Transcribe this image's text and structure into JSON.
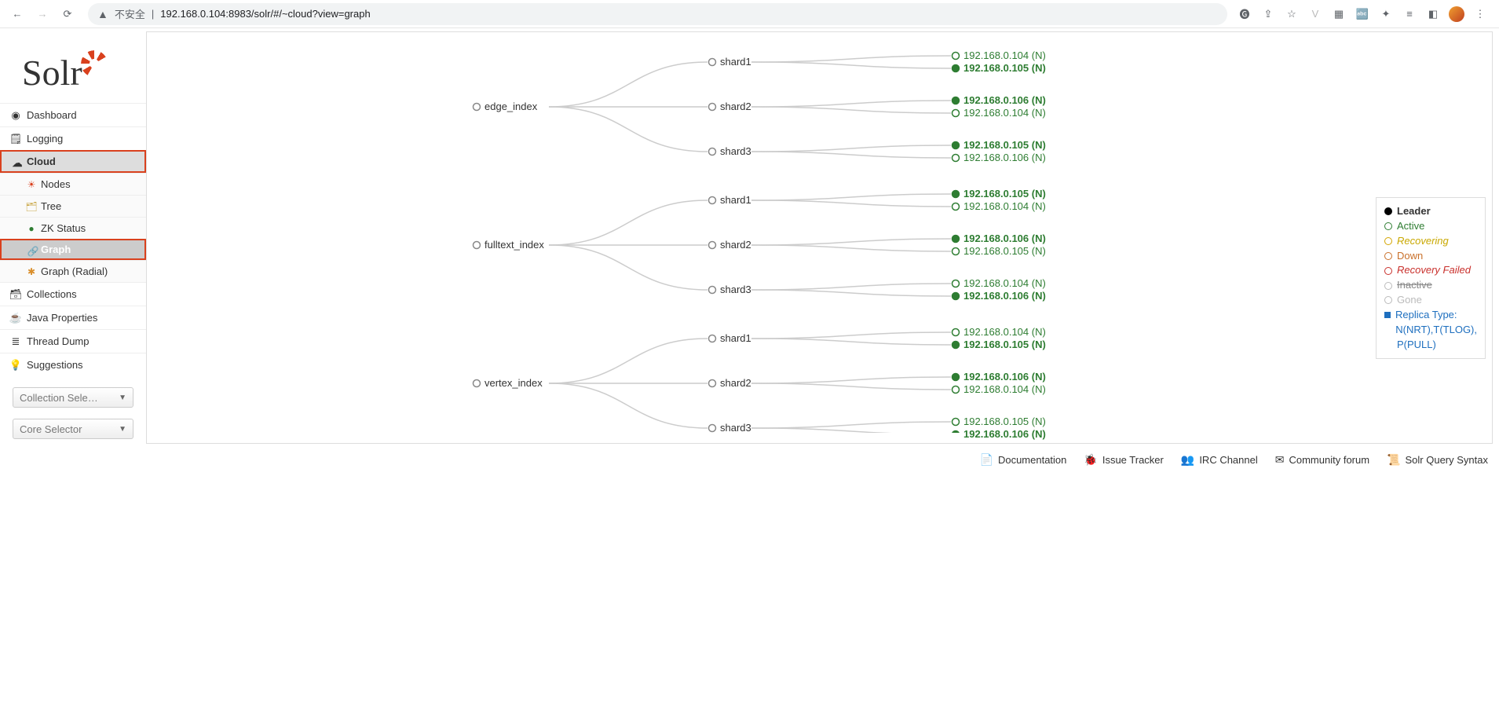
{
  "browser": {
    "insecure_label": "不安全",
    "url": "192.168.0.104:8983/solr/#/~cloud?view=graph"
  },
  "logo_text": "Solr",
  "nav": {
    "dashboard": "Dashboard",
    "logging": "Logging",
    "cloud": "Cloud",
    "collections": "Collections",
    "java_properties": "Java Properties",
    "thread_dump": "Thread Dump",
    "suggestions": "Suggestions"
  },
  "cloud_sub": {
    "nodes": "Nodes",
    "tree": "Tree",
    "zk_status": "ZK Status",
    "graph": "Graph",
    "graph_radial": "Graph (Radial)"
  },
  "selectors": {
    "collection": "Collection Sele…",
    "core": "Core Selector"
  },
  "legend": {
    "leader": "Leader",
    "active": "Active",
    "recovering": "Recovering",
    "down": "Down",
    "recovery_failed": "Recovery Failed",
    "inactive": "Inactive",
    "gone": "Gone",
    "replica_type_l1": "Replica Type:",
    "replica_type_l2": "N(NRT),T(TLOG),",
    "replica_type_l3": "P(PULL)"
  },
  "footer": {
    "documentation": "Documentation",
    "issue_tracker": "Issue Tracker",
    "irc_channel": "IRC Channel",
    "community_forum": "Community forum",
    "query_syntax": "Solr Query Syntax"
  },
  "graph": {
    "collections": [
      {
        "name": "edge_index",
        "shards": [
          {
            "name": "shard1",
            "replicas": [
              {
                "label": "192.168.0.104 (N)",
                "leader": false
              },
              {
                "label": "192.168.0.105 (N)",
                "leader": true
              }
            ]
          },
          {
            "name": "shard2",
            "replicas": [
              {
                "label": "192.168.0.106 (N)",
                "leader": true
              },
              {
                "label": "192.168.0.104 (N)",
                "leader": false
              }
            ]
          },
          {
            "name": "shard3",
            "replicas": [
              {
                "label": "192.168.0.105 (N)",
                "leader": true
              },
              {
                "label": "192.168.0.106 (N)",
                "leader": false
              }
            ]
          }
        ]
      },
      {
        "name": "fulltext_index",
        "shards": [
          {
            "name": "shard1",
            "replicas": [
              {
                "label": "192.168.0.105 (N)",
                "leader": true
              },
              {
                "label": "192.168.0.104 (N)",
                "leader": false
              }
            ]
          },
          {
            "name": "shard2",
            "replicas": [
              {
                "label": "192.168.0.106 (N)",
                "leader": true
              },
              {
                "label": "192.168.0.105 (N)",
                "leader": false
              }
            ]
          },
          {
            "name": "shard3",
            "replicas": [
              {
                "label": "192.168.0.104 (N)",
                "leader": false
              },
              {
                "label": "192.168.0.106 (N)",
                "leader": true
              }
            ]
          }
        ]
      },
      {
        "name": "vertex_index",
        "shards": [
          {
            "name": "shard1",
            "replicas": [
              {
                "label": "192.168.0.104 (N)",
                "leader": false
              },
              {
                "label": "192.168.0.105 (N)",
                "leader": true
              }
            ]
          },
          {
            "name": "shard2",
            "replicas": [
              {
                "label": "192.168.0.106 (N)",
                "leader": true
              },
              {
                "label": "192.168.0.104 (N)",
                "leader": false
              }
            ]
          },
          {
            "name": "shard3",
            "replicas": [
              {
                "label": "192.168.0.105 (N)",
                "leader": false
              },
              {
                "label": "192.168.0.106 (N)",
                "leader": true
              }
            ]
          }
        ]
      }
    ]
  }
}
